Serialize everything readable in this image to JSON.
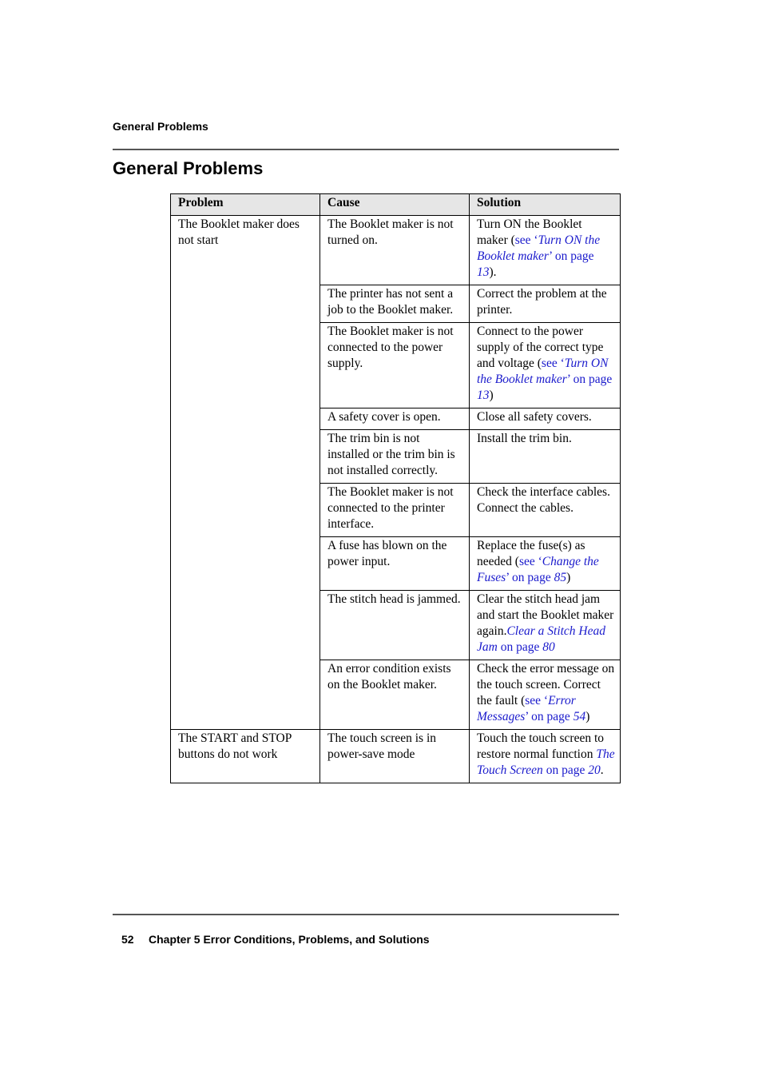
{
  "running_header": "General Problems",
  "page_title": "General Problems",
  "table": {
    "headers": [
      "Problem",
      "Cause",
      "Solution"
    ],
    "groups": [
      {
        "problem": "The Booklet maker does not start",
        "rows": [
          {
            "cause": "The Booklet maker is not turned on.",
            "solution": {
              "text": "Turn ON the Booklet maker (",
              "link_pre": "see ‘",
              "link_italic": "Turn ON the Booklet maker",
              "link_mid": "’ on page ",
              "link_page": "13",
              "text_after": ")."
            }
          },
          {
            "cause": "The printer has not sent a job to the Booklet maker.",
            "solution": {
              "text": "Correct the problem at the printer."
            }
          },
          {
            "cause": "The Booklet maker is not connected to the power supply.",
            "solution": {
              "text": "Connect to the power supply of the correct type and voltage (",
              "link_pre": "see ‘",
              "link_italic": "Turn ON the Booklet maker",
              "link_mid": "’ on page ",
              "link_page": "13",
              "text_after": ")"
            }
          },
          {
            "cause": "A safety cover is open.",
            "solution": {
              "text": "Close all safety covers."
            }
          },
          {
            "cause": "The trim bin is not installed or the trim bin is not installed correctly.",
            "solution": {
              "text": "Install the trim bin."
            }
          },
          {
            "cause": "The Booklet maker is not connected to the printer interface.",
            "solution": {
              "text": "Check the interface cables. Connect the cables."
            }
          },
          {
            "cause": "A fuse has blown on the power input.",
            "solution": {
              "text": "Replace the fuse(s) as needed (",
              "link_pre": "see ‘",
              "link_italic": "Change the Fuses",
              "link_mid": "’ on page ",
              "link_page": "85",
              "text_after": ")"
            }
          },
          {
            "cause": "The stitch head is jammed.",
            "solution": {
              "text": "Clear the stitch head jam and start the Booklet maker again.",
              "link_pre": "",
              "link_italic": "Clear a Stitch Head Jam",
              "link_mid": " on page ",
              "link_page": "80",
              "text_after": ""
            }
          },
          {
            "cause": "An error condition exists on the Booklet maker.",
            "solution": {
              "text": "Check the error message on the touch screen. Correct the fault (",
              "link_pre": "see ‘",
              "link_italic": "Error Messages",
              "link_mid": "’ on page ",
              "link_page": "54",
              "text_after": ")"
            }
          }
        ]
      },
      {
        "problem": "The START and STOP buttons do not work",
        "rows": [
          {
            "cause": "The touch screen is in power-save mode",
            "solution": {
              "text": "Touch the touch screen to restore normal function ",
              "link_pre": "",
              "link_italic": "The Touch Screen",
              "link_mid": " on page ",
              "link_page": "20",
              "text_after": "."
            }
          }
        ]
      }
    ]
  },
  "footer": {
    "page_number": "52",
    "chapter": "Chapter 5 Error Conditions, Problems, and Solutions"
  },
  "colors": {
    "link": "#1a1acc",
    "header_bg": "#e6e6e6",
    "rule": "#555555"
  }
}
